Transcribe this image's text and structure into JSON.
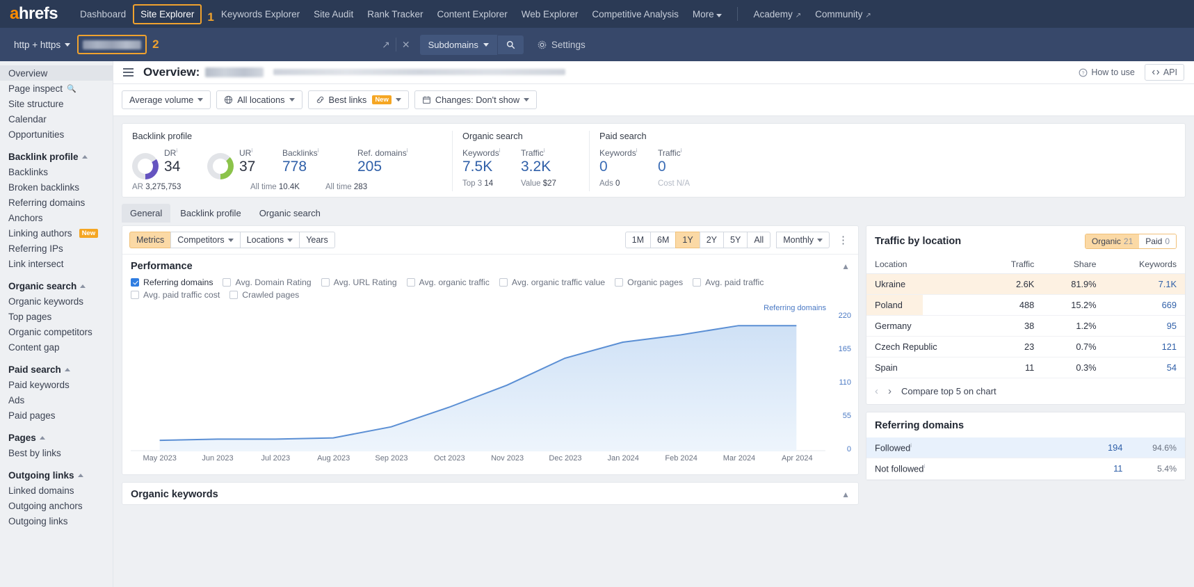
{
  "topnav": {
    "logo": "ahrefs",
    "items": [
      {
        "label": "Dashboard",
        "boxed": false
      },
      {
        "label": "Site Explorer",
        "boxed": true,
        "callout": "1"
      },
      {
        "label": "Keywords Explorer",
        "boxed": false
      },
      {
        "label": "Site Audit",
        "boxed": false
      },
      {
        "label": "Rank Tracker",
        "boxed": false
      },
      {
        "label": "Content Explorer",
        "boxed": false
      },
      {
        "label": "Web Explorer",
        "boxed": false
      },
      {
        "label": "Competitive Analysis",
        "boxed": false
      },
      {
        "label": "More",
        "boxed": false,
        "caret": true
      }
    ],
    "right_items": [
      {
        "label": "Academy",
        "external": true
      },
      {
        "label": "Community",
        "external": true
      }
    ]
  },
  "searchbar": {
    "protocol": "http + https",
    "url_value": "",
    "url_callout": "2",
    "scope": "Subdomains",
    "search_icon": "search-icon",
    "settings_label": "Settings",
    "open_icon": "open-in-new-icon",
    "clear_icon": "close-icon"
  },
  "sidebar": {
    "groups": [
      {
        "header": null,
        "items": [
          {
            "label": "Overview",
            "selected": true
          },
          {
            "label": "Page inspect",
            "icon": "magnifier-icon"
          },
          {
            "label": "Site structure"
          },
          {
            "label": "Calendar"
          },
          {
            "label": "Opportunities"
          }
        ]
      },
      {
        "header": "Backlink profile",
        "items": [
          {
            "label": "Backlinks"
          },
          {
            "label": "Broken backlinks"
          },
          {
            "label": "Referring domains"
          },
          {
            "label": "Anchors"
          },
          {
            "label": "Linking authors",
            "badge": "New"
          },
          {
            "label": "Referring IPs"
          },
          {
            "label": "Link intersect"
          }
        ]
      },
      {
        "header": "Organic search",
        "items": [
          {
            "label": "Organic keywords"
          },
          {
            "label": "Top pages"
          },
          {
            "label": "Organic competitors"
          },
          {
            "label": "Content gap"
          }
        ]
      },
      {
        "header": "Paid search",
        "items": [
          {
            "label": "Paid keywords"
          },
          {
            "label": "Ads"
          },
          {
            "label": "Paid pages"
          }
        ]
      },
      {
        "header": "Pages",
        "items": [
          {
            "label": "Best by links"
          }
        ]
      },
      {
        "header": "Outgoing links",
        "items": [
          {
            "label": "Linked domains"
          },
          {
            "label": "Outgoing anchors"
          },
          {
            "label": "Outgoing links"
          }
        ]
      }
    ]
  },
  "page": {
    "title": "Overview:",
    "how_to_use": "How to use",
    "api": "API"
  },
  "filters": [
    {
      "label": "Average volume",
      "caret": true
    },
    {
      "label": "All locations",
      "icon": "globe-icon",
      "caret": true
    },
    {
      "label": "Best links",
      "icon": "link-icon",
      "badge": "New",
      "caret": true
    },
    {
      "label": "Changes: Don't show",
      "icon": "calendar-icon",
      "caret": true
    }
  ],
  "metrics": {
    "backlink_profile": {
      "title": "Backlink profile",
      "dr": {
        "label": "DR",
        "value": "34",
        "sub_label": "AR",
        "sub_value": "3,275,753"
      },
      "ur": {
        "label": "UR",
        "value": "37"
      },
      "backlinks": {
        "label": "Backlinks",
        "value": "778",
        "sub_label": "All time",
        "sub_value": "10.4K"
      },
      "ref_domains": {
        "label": "Ref. domains",
        "value": "205",
        "sub_label": "All time",
        "sub_value": "283"
      }
    },
    "organic_search": {
      "title": "Organic search",
      "keywords": {
        "label": "Keywords",
        "value": "7.5K",
        "sub_label": "Top 3",
        "sub_value": "14"
      },
      "traffic": {
        "label": "Traffic",
        "value": "3.2K",
        "sub_label": "Value",
        "sub_value": "$27"
      }
    },
    "paid_search": {
      "title": "Paid search",
      "keywords": {
        "label": "Keywords",
        "value": "0",
        "sub_label": "Ads",
        "sub_value": "0"
      },
      "traffic": {
        "label": "Traffic",
        "value": "0",
        "sub_label": "Cost",
        "sub_value": "N/A"
      }
    }
  },
  "tabs": [
    {
      "label": "General",
      "active": true
    },
    {
      "label": "Backlink profile",
      "active": false
    },
    {
      "label": "Organic search",
      "active": false
    }
  ],
  "chart_toolbar": {
    "left_seg": [
      {
        "label": "Metrics",
        "on": true
      },
      {
        "label": "Competitors",
        "caret": true
      },
      {
        "label": "Locations",
        "caret": true
      },
      {
        "label": "Years"
      }
    ],
    "ranges": [
      {
        "label": "1M",
        "on": false
      },
      {
        "label": "6M",
        "on": false
      },
      {
        "label": "1Y",
        "on": true
      },
      {
        "label": "2Y",
        "on": false
      },
      {
        "label": "5Y",
        "on": false
      },
      {
        "label": "All",
        "on": false
      }
    ],
    "granularity": "Monthly",
    "kebab": "more-options-icon"
  },
  "performance": {
    "title": "Performance",
    "collapse_icon": "chevron-up-icon",
    "checkboxes": [
      {
        "label": "Referring domains",
        "checked": true
      },
      {
        "label": "Avg. Domain Rating",
        "checked": false
      },
      {
        "label": "Avg. URL Rating",
        "checked": false
      },
      {
        "label": "Avg. organic traffic",
        "checked": false
      },
      {
        "label": "Avg. organic traffic value",
        "checked": false
      },
      {
        "label": "Organic pages",
        "checked": false
      },
      {
        "label": "Avg. paid traffic",
        "checked": false
      },
      {
        "label": "Avg. paid traffic cost",
        "checked": false
      },
      {
        "label": "Crawled pages",
        "checked": false
      }
    ]
  },
  "chart_data": {
    "type": "area",
    "title": "Performance",
    "series_label": "Referring domains",
    "legend": "Referring domains",
    "legend_position": "top-right",
    "xlabel": "",
    "ylabel": "Referring domains",
    "grid": false,
    "ylim": [
      0,
      220
    ],
    "yticks": [
      0,
      55,
      110,
      165,
      220
    ],
    "ytick_labels": [
      "0",
      "55",
      "110",
      "165",
      "220"
    ],
    "categories": [
      "May 2023",
      "Jun 2023",
      "Jul 2023",
      "Aug 2023",
      "Sep 2023",
      "Oct 2023",
      "Nov 2023",
      "Dec 2023",
      "Jan 2024",
      "Feb 2024",
      "Mar 2024",
      "Apr 2024"
    ],
    "values": [
      18,
      20,
      20,
      22,
      40,
      72,
      108,
      152,
      178,
      190,
      205,
      205
    ],
    "color": "#5b8fd4",
    "fill_color": "#d9e7f7"
  },
  "traffic_by_location": {
    "title": "Traffic by location",
    "toggle": [
      {
        "label": "Organic",
        "count": "21",
        "on": true
      },
      {
        "label": "Paid",
        "count": "0",
        "on": false
      }
    ],
    "columns": [
      "Location",
      "Traffic",
      "Share",
      "Keywords"
    ],
    "rows": [
      {
        "location": "Ukraine",
        "traffic": "2.6K",
        "share": "81.9%",
        "keywords": "7.1K",
        "highlight": true,
        "bar": 100
      },
      {
        "location": "Poland",
        "traffic": "488",
        "share": "15.2%",
        "keywords": "669",
        "highlight": false,
        "bar": 48
      },
      {
        "location": "Germany",
        "traffic": "38",
        "share": "1.2%",
        "keywords": "95",
        "highlight": false,
        "bar": 0
      },
      {
        "location": "Czech Republic",
        "traffic": "23",
        "share": "0.7%",
        "keywords": "121",
        "highlight": false,
        "bar": 0
      },
      {
        "location": "Spain",
        "traffic": "11",
        "share": "0.3%",
        "keywords": "54",
        "highlight": false,
        "bar": 0
      }
    ],
    "compare_label": "Compare top 5 on chart",
    "prev_icon": "chevron-left-icon",
    "next_icon": "chevron-right-icon"
  },
  "referring_domains": {
    "title": "Referring domains",
    "rows": [
      {
        "label": "Followed",
        "value": "194",
        "pct": "94.6%",
        "highlight": true
      },
      {
        "label": "Not followed",
        "value": "11",
        "pct": "5.4%",
        "highlight": false
      }
    ]
  },
  "organic_keywords_panel": {
    "title": "Organic keywords",
    "collapse_icon": "chevron-up-icon"
  },
  "colors": {
    "brand_orange": "#ff8c00",
    "nav_bg": "#2b3a55",
    "search_bg": "#37486a",
    "link_blue": "#2f5fa8",
    "highlight": "#fbd9a5",
    "dr_purple": "#6554c0",
    "ur_green": "#8bc34a"
  }
}
